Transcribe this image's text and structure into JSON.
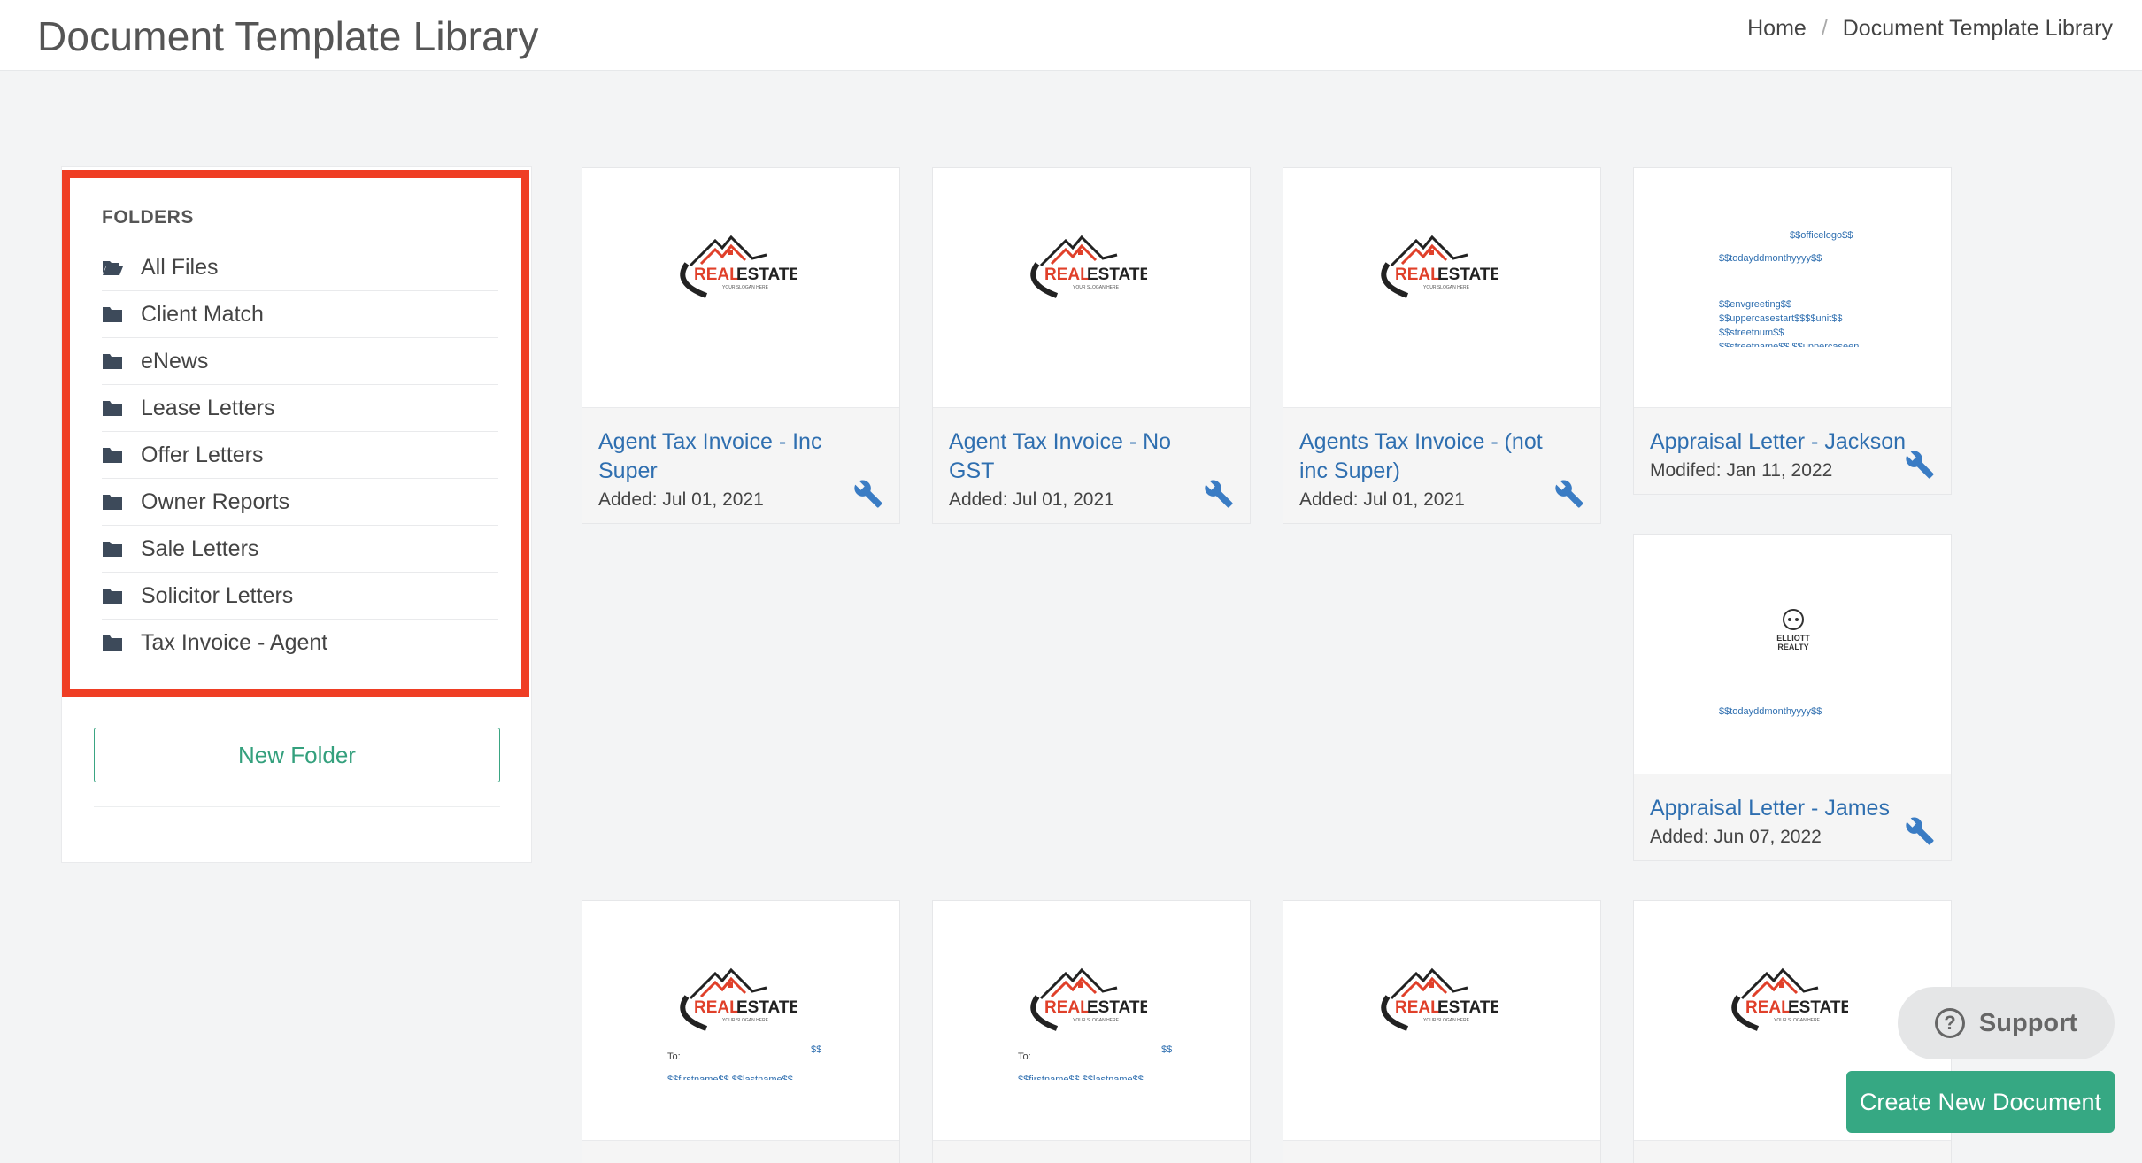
{
  "header": {
    "title": "Document Template Library",
    "breadcrumb": {
      "home": "Home",
      "separator": "/",
      "current": "Document Template Library"
    }
  },
  "sidebar": {
    "folders_title": "FOLDERS",
    "folders": [
      {
        "label": "All Files",
        "icon": "folder-open-icon"
      },
      {
        "label": "Client Match",
        "icon": "folder-icon"
      },
      {
        "label": "eNews",
        "icon": "folder-icon"
      },
      {
        "label": "Lease Letters",
        "icon": "folder-icon"
      },
      {
        "label": "Offer Letters",
        "icon": "folder-icon"
      },
      {
        "label": "Owner Reports",
        "icon": "folder-icon"
      },
      {
        "label": "Sale Letters",
        "icon": "folder-icon"
      },
      {
        "label": "Solicitor Letters",
        "icon": "folder-icon"
      },
      {
        "label": "Tax Invoice - Agent",
        "icon": "folder-icon"
      }
    ],
    "new_folder_label": "New Folder",
    "highlight_color": "#ef3e24"
  },
  "cards": [
    {
      "title": "Agent Tax Invoice - Inc Super",
      "date": "Added: Jul 01, 2021",
      "thumb": "realestate-logo"
    },
    {
      "title": "Agent Tax Invoice - No GST",
      "date": "Added: Jul 01, 2021",
      "thumb": "realestate-logo"
    },
    {
      "title": "Agents Tax Invoice - (not inc Super)",
      "date": "Added: Jul 01, 2021",
      "thumb": "realestate-logo"
    },
    {
      "title": "Appraisal Letter - Jackson",
      "date": "Modifed: Jan 11, 2022",
      "thumb": "text-template",
      "thumb_text": {
        "logo_tag": "$$officelogo$$",
        "date_tag": "$$todayddmonthyyyy$$",
        "greeting": "$$envgreeting$$",
        "address": "$$uppercasestart$$$$unit$$",
        "street": "$$streetnum$$",
        "cut": "$$streetname$$ $$uppercaseen"
      }
    },
    {
      "title": "Appraisal Letter - James",
      "date": "Added: Jun 07, 2022",
      "thumb": "elliott-logo",
      "thumb_text": {
        "brand_line1": "ELLIOTT",
        "brand_line2": "REALTY",
        "date_tag": "$$todayddmonthyyyy$$"
      }
    },
    {
      "thumb": "realestate-letter",
      "thumb_text": {
        "to": "To:",
        "names": "$$firstname$$ $$lastname$$",
        "corner": "$$"
      }
    },
    {
      "thumb": "realestate-letter",
      "thumb_text": {
        "to": "To:",
        "names": "$$firstname$$ $$lastname$$",
        "corner": "$$"
      }
    },
    {
      "thumb": "realestate-logo"
    },
    {
      "thumb": "realestate-logo"
    }
  ],
  "logo_text": {
    "real": "REAL",
    "estate": "ESTATE",
    "slogan": "YOUR SLOGAN HERE"
  },
  "support_label": "Support",
  "create_label": "Create New Document",
  "colors": {
    "accent_green": "#36a883",
    "link_blue": "#2f6fb0",
    "highlight_red": "#ef3e24"
  }
}
